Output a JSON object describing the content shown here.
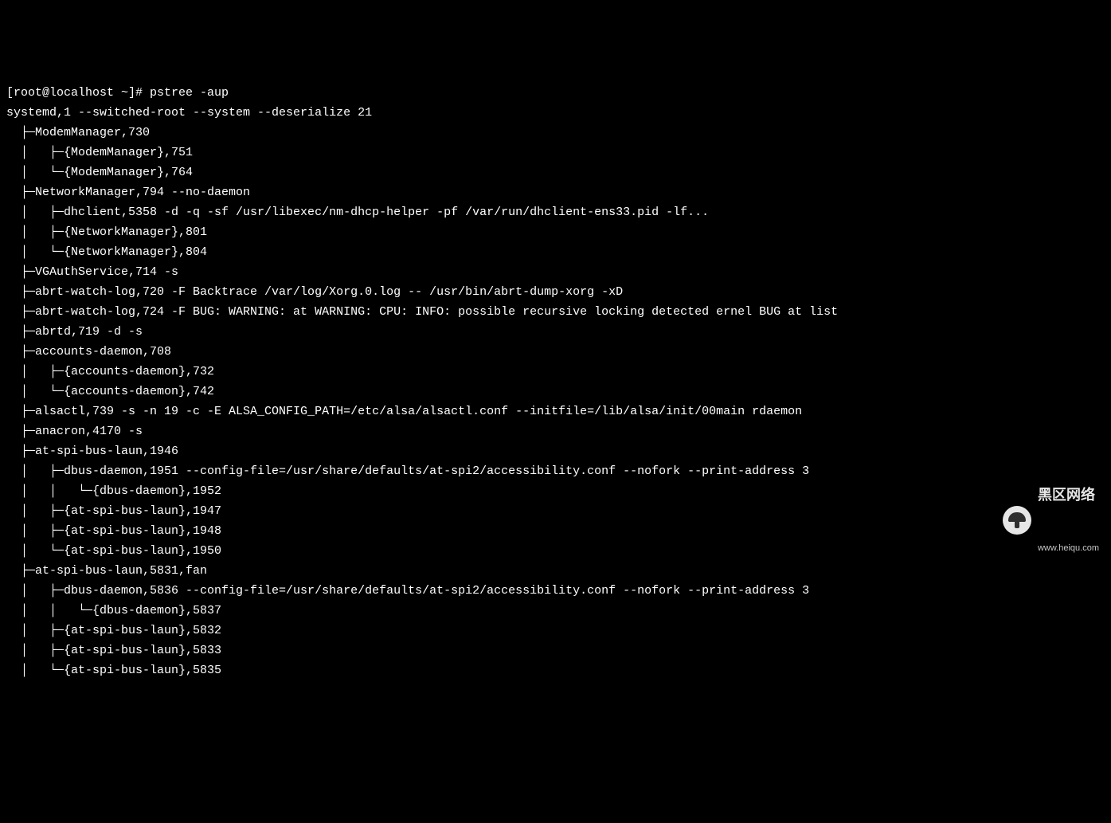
{
  "prompt": "[root@localhost ~]# ",
  "command": "pstree -aup",
  "lines": [
    "systemd,1 --switched-root --system --deserialize 21",
    "  ├─ModemManager,730",
    "  │   ├─{ModemManager},751",
    "  │   └─{ModemManager},764",
    "  ├─NetworkManager,794 --no-daemon",
    "  │   ├─dhclient,5358 -d -q -sf /usr/libexec/nm-dhcp-helper -pf /var/run/dhclient-ens33.pid -lf...",
    "  │   ├─{NetworkManager},801",
    "  │   └─{NetworkManager},804",
    "  ├─VGAuthService,714 -s",
    "  ├─abrt-watch-log,720 -F Backtrace /var/log/Xorg.0.log -- /usr/bin/abrt-dump-xorg -xD",
    "  ├─abrt-watch-log,724 -F BUG: WARNING: at WARNING: CPU: INFO: possible recursive locking detected ernel BUG at list",
    "  ├─abrtd,719 -d -s",
    "  ├─accounts-daemon,708",
    "  │   ├─{accounts-daemon},732",
    "  │   └─{accounts-daemon},742",
    "  ├─alsactl,739 -s -n 19 -c -E ALSA_CONFIG_PATH=/etc/alsa/alsactl.conf --initfile=/lib/alsa/init/00main rdaemon",
    "  ├─anacron,4170 -s",
    "  ├─at-spi-bus-laun,1946",
    "  │   ├─dbus-daemon,1951 --config-file=/usr/share/defaults/at-spi2/accessibility.conf --nofork --print-address 3",
    "  │   │   └─{dbus-daemon},1952",
    "  │   ├─{at-spi-bus-laun},1947",
    "  │   ├─{at-spi-bus-laun},1948",
    "  │   └─{at-spi-bus-laun},1950",
    "  ├─at-spi-bus-laun,5831,fan",
    "  │   ├─dbus-daemon,5836 --config-file=/usr/share/defaults/at-spi2/accessibility.conf --nofork --print-address 3",
    "  │   │   └─{dbus-daemon},5837",
    "  │   ├─{at-spi-bus-laun},5832",
    "  │   ├─{at-spi-bus-laun},5833",
    "  │   └─{at-spi-bus-laun},5835"
  ],
  "watermark": {
    "title": "黑区网络",
    "url": "www.heiqu.com"
  }
}
